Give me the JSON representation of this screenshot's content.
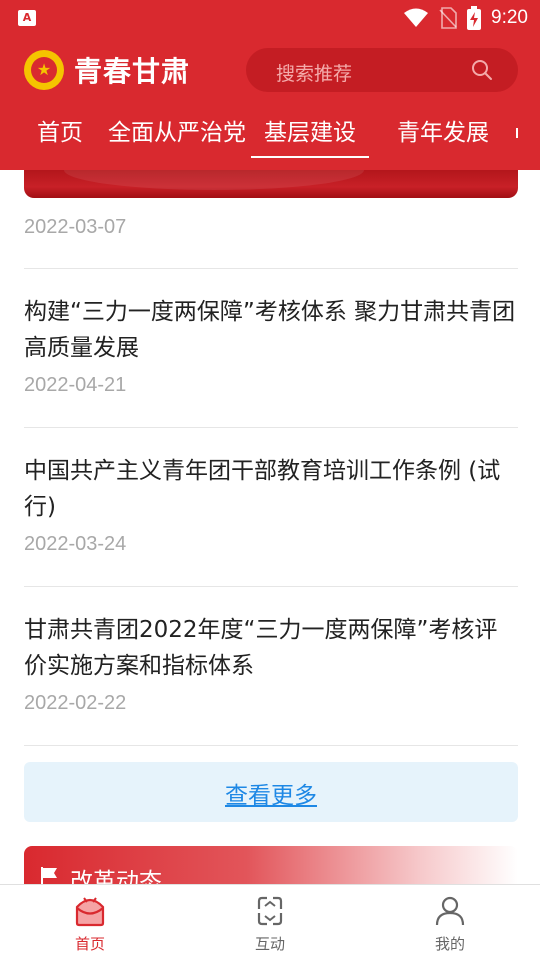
{
  "status": {
    "time": "9:20",
    "app_letter": "A"
  },
  "header": {
    "brand": "青春甘肃",
    "search_placeholder": "搜索推荐",
    "tabs": [
      {
        "label": "首页"
      },
      {
        "label": "全面从严治党"
      },
      {
        "label": "基层建设"
      },
      {
        "label": "青年发展"
      }
    ]
  },
  "articles": {
    "first_date": "2022-03-07",
    "items": [
      {
        "title": "构建“三力一度两保障”考核体系 聚力甘肃共青团高质量发展",
        "date": "2022-04-21"
      },
      {
        "title": "中国共产主义青年团干部教育培训工作条例 (试行)",
        "date": "2022-03-24"
      },
      {
        "title": "甘肃共青团2022年度“三力一度两保障”考核评价实施方案和指标体系",
        "date": "2022-02-22"
      }
    ]
  },
  "more_label": "查看更多",
  "section_title": "改革动态",
  "bottom_nav": [
    {
      "label": "首页",
      "icon": "home-icon",
      "active": true
    },
    {
      "label": "互动",
      "icon": "interact-icon",
      "active": false
    },
    {
      "label": "我的",
      "icon": "profile-icon",
      "active": false
    }
  ],
  "colors": {
    "primary": "#d9292f",
    "link": "#1e88e5"
  }
}
